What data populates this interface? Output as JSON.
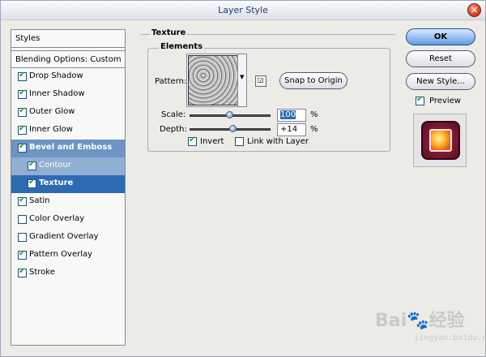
{
  "window": {
    "title": "Layer Style"
  },
  "sidebar": {
    "header": "Styles",
    "blending": "Blending Options: Custom",
    "items": [
      {
        "label": "Drop Shadow",
        "checked": true
      },
      {
        "label": "Inner Shadow",
        "checked": true
      },
      {
        "label": "Outer Glow",
        "checked": true
      },
      {
        "label": "Inner Glow",
        "checked": true
      },
      {
        "label": "Bevel and Emboss",
        "checked": true,
        "selected": "parent"
      },
      {
        "label": "Contour",
        "checked": true,
        "selected": "child"
      },
      {
        "label": "Texture",
        "checked": true,
        "selected": "active"
      },
      {
        "label": "Satin",
        "checked": true
      },
      {
        "label": "Color Overlay",
        "checked": false
      },
      {
        "label": "Gradient Overlay",
        "checked": false
      },
      {
        "label": "Pattern Overlay",
        "checked": true
      },
      {
        "label": "Stroke",
        "checked": true
      }
    ]
  },
  "texture": {
    "section_title": "Texture",
    "elements_title": "Elements",
    "pattern_label": "Pattern:",
    "snap_button": "Snap to Origin",
    "scale_label": "Scale:",
    "scale_value": "100",
    "scale_unit": "%",
    "scale_position": 0.5,
    "depth_label": "Depth:",
    "depth_value": "+14",
    "depth_unit": "%",
    "depth_position": 0.54,
    "invert_label": "Invert",
    "invert_checked": true,
    "link_label": "Link with Layer",
    "link_checked": false
  },
  "actions": {
    "ok": "OK",
    "reset": "Reset",
    "new_style": "New Style...",
    "preview_label": "Preview",
    "preview_checked": true
  },
  "watermark": {
    "main": "Bai🐾经验",
    "sub": "jingyan.baidu.com"
  }
}
